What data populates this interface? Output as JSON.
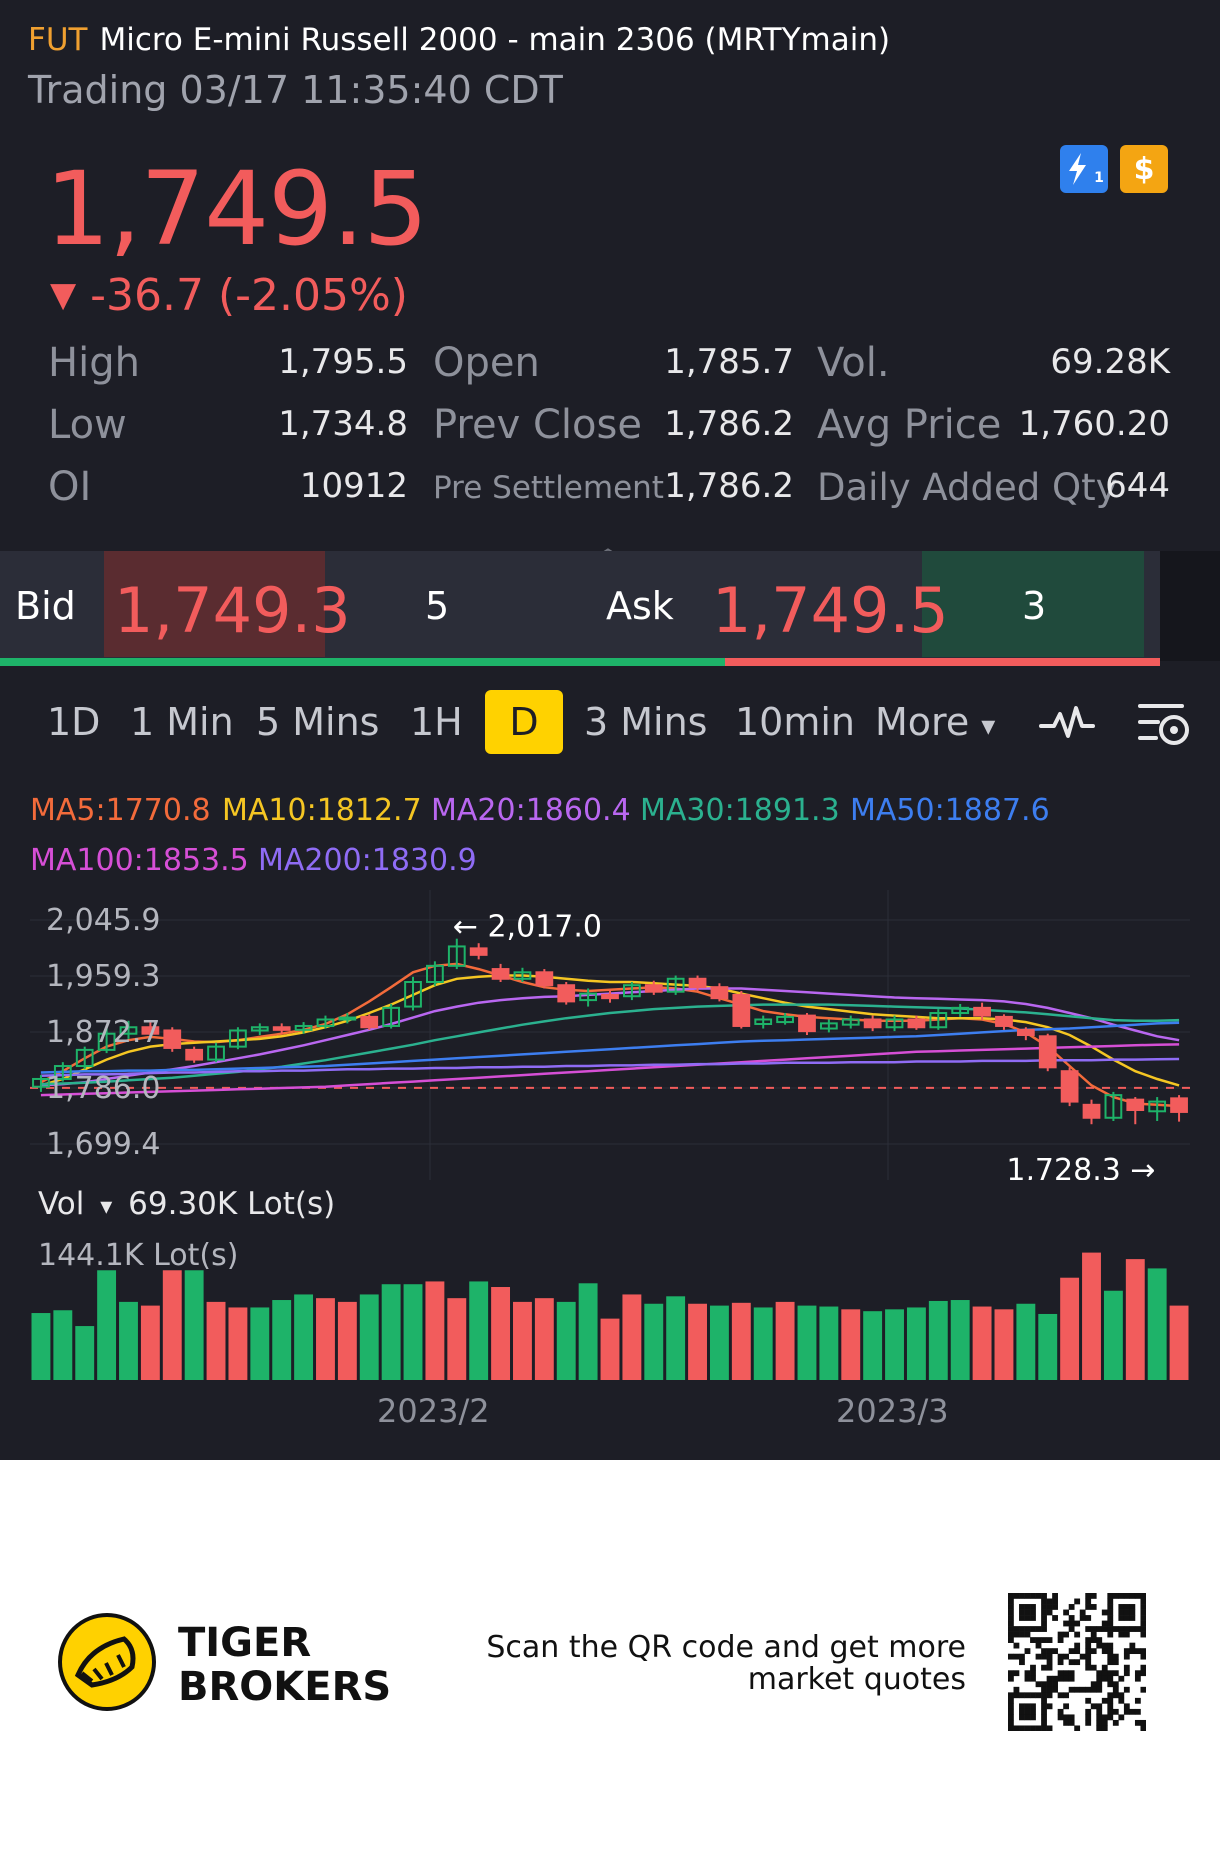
{
  "header": {
    "tag": "FUT",
    "title": "Micro E-mini Russell 2000 - main 2306 (MRTYmain)",
    "status": "Trading 03/17 11:35:40 CDT",
    "badges": {
      "flash_icon": "lightning-icon",
      "flash_sub": "1",
      "dollar_icon": "dollar-icon",
      "dollar_symbol": "$"
    }
  },
  "quote": {
    "last": "1,749.5",
    "change": "-36.7 (-2.05%)",
    "direction_arrow": "▼",
    "color_down": "#f25c5c",
    "color_up": "#1eb369"
  },
  "stats": {
    "col1": [
      {
        "label": "High",
        "value": "1,795.5"
      },
      {
        "label": "Low",
        "value": "1,734.8"
      },
      {
        "label": "OI",
        "value": "10912"
      }
    ],
    "col2": [
      {
        "label": "Open",
        "value": "1,785.7"
      },
      {
        "label": "Prev Close",
        "value": "1,786.2"
      },
      {
        "label": "Pre Settlement",
        "value": "1,786.2"
      }
    ],
    "col3": [
      {
        "label": "Vol.",
        "value": "69.28K"
      },
      {
        "label": "Avg Price",
        "value": "1,760.20"
      },
      {
        "label": "Daily Added Qty",
        "value": "644"
      }
    ],
    "collapse_caret": "︿"
  },
  "orderbook": {
    "bid_label": "Bid",
    "bid_price": "1,749.3",
    "bid_size": "5",
    "ask_label": "Ask",
    "ask_price": "1,749.5",
    "ask_size": "3"
  },
  "periods": {
    "items": [
      "1D",
      "1 Min",
      "5 Mins",
      "1H",
      "D",
      "3 Mins",
      "10min"
    ],
    "active": "D",
    "more_label": "More",
    "more_caret": "▾"
  },
  "chart_toolbar": {
    "indicator_icon": "indicator-wave-icon",
    "settings_icon": "chart-settings-icon"
  },
  "moving_averages": [
    {
      "label": "MA5:1770.8",
      "color": "#f36b3b"
    },
    {
      "label": "MA10:1812.7",
      "color": "#f5c623"
    },
    {
      "label": "MA20:1860.4",
      "color": "#b967f0"
    },
    {
      "label": "MA30:1891.3",
      "color": "#2bb18f"
    },
    {
      "label": "MA50:1887.6",
      "color": "#3d7ef0"
    },
    {
      "label": "MA100:1853.5",
      "color": "#d64fd6"
    },
    {
      "label": "MA200:1830.9",
      "color": "#8f6cf5"
    }
  ],
  "chart_data": [
    {
      "type": "candlestick",
      "title": "",
      "y_ticks": [
        "2,045.9",
        "1,959.3",
        "1,872.7",
        "1,786.0",
        "1,699.4"
      ],
      "ylim": [
        1699.4,
        2045.9
      ],
      "high_marker": "2,017.0",
      "low_marker": "1,728.3",
      "prev_close_line": 1786.2,
      "x_ticks": [
        "2023/2",
        "2023/3"
      ],
      "candles": [
        {
          "o": 1788,
          "c": 1800,
          "h": 1806,
          "l": 1780
        },
        {
          "o": 1800,
          "c": 1820,
          "h": 1826,
          "l": 1796
        },
        {
          "o": 1820,
          "c": 1845,
          "h": 1850,
          "l": 1815
        },
        {
          "o": 1845,
          "c": 1870,
          "h": 1880,
          "l": 1840
        },
        {
          "o": 1870,
          "c": 1880,
          "h": 1890,
          "l": 1862
        },
        {
          "o": 1880,
          "c": 1870,
          "h": 1888,
          "l": 1862
        },
        {
          "o": 1875,
          "c": 1848,
          "h": 1880,
          "l": 1842
        },
        {
          "o": 1845,
          "c": 1830,
          "h": 1850,
          "l": 1825
        },
        {
          "o": 1830,
          "c": 1850,
          "h": 1856,
          "l": 1826
        },
        {
          "o": 1850,
          "c": 1875,
          "h": 1880,
          "l": 1846
        },
        {
          "o": 1875,
          "c": 1880,
          "h": 1886,
          "l": 1868
        },
        {
          "o": 1880,
          "c": 1876,
          "h": 1886,
          "l": 1870
        },
        {
          "o": 1876,
          "c": 1882,
          "h": 1888,
          "l": 1870
        },
        {
          "o": 1882,
          "c": 1892,
          "h": 1898,
          "l": 1878
        },
        {
          "o": 1892,
          "c": 1895,
          "h": 1902,
          "l": 1886
        },
        {
          "o": 1896,
          "c": 1880,
          "h": 1900,
          "l": 1876
        },
        {
          "o": 1882,
          "c": 1910,
          "h": 1916,
          "l": 1878
        },
        {
          "o": 1912,
          "c": 1950,
          "h": 1958,
          "l": 1906
        },
        {
          "o": 1950,
          "c": 1975,
          "h": 1982,
          "l": 1944
        },
        {
          "o": 1975,
          "c": 2005,
          "h": 2017,
          "l": 1970
        },
        {
          "o": 2002,
          "c": 1992,
          "h": 2010,
          "l": 1985
        },
        {
          "o": 1970,
          "c": 1955,
          "h": 1978,
          "l": 1950
        },
        {
          "o": 1955,
          "c": 1965,
          "h": 1972,
          "l": 1950
        },
        {
          "o": 1965,
          "c": 1945,
          "h": 1970,
          "l": 1940
        },
        {
          "o": 1945,
          "c": 1920,
          "h": 1950,
          "l": 1915
        },
        {
          "o": 1922,
          "c": 1932,
          "h": 1940,
          "l": 1912
        },
        {
          "o": 1930,
          "c": 1925,
          "h": 1938,
          "l": 1918
        },
        {
          "o": 1928,
          "c": 1945,
          "h": 1950,
          "l": 1922
        },
        {
          "o": 1945,
          "c": 1935,
          "h": 1952,
          "l": 1930
        },
        {
          "o": 1935,
          "c": 1955,
          "h": 1960,
          "l": 1930
        },
        {
          "o": 1955,
          "c": 1942,
          "h": 1960,
          "l": 1936
        },
        {
          "o": 1942,
          "c": 1925,
          "h": 1948,
          "l": 1920
        },
        {
          "o": 1930,
          "c": 1882,
          "h": 1936,
          "l": 1878
        },
        {
          "o": 1885,
          "c": 1892,
          "h": 1898,
          "l": 1878
        },
        {
          "o": 1888,
          "c": 1896,
          "h": 1902,
          "l": 1884
        },
        {
          "o": 1898,
          "c": 1874,
          "h": 1902,
          "l": 1868
        },
        {
          "o": 1878,
          "c": 1886,
          "h": 1892,
          "l": 1872
        },
        {
          "o": 1884,
          "c": 1892,
          "h": 1898,
          "l": 1878
        },
        {
          "o": 1892,
          "c": 1880,
          "h": 1898,
          "l": 1874
        },
        {
          "o": 1880,
          "c": 1892,
          "h": 1898,
          "l": 1874
        },
        {
          "o": 1892,
          "c": 1880,
          "h": 1898,
          "l": 1876
        },
        {
          "o": 1880,
          "c": 1902,
          "h": 1908,
          "l": 1876
        },
        {
          "o": 1902,
          "c": 1910,
          "h": 1916,
          "l": 1896
        },
        {
          "o": 1910,
          "c": 1898,
          "h": 1918,
          "l": 1892
        },
        {
          "o": 1896,
          "c": 1882,
          "h": 1900,
          "l": 1876
        },
        {
          "o": 1876,
          "c": 1868,
          "h": 1880,
          "l": 1860
        },
        {
          "o": 1866,
          "c": 1818,
          "h": 1870,
          "l": 1812
        },
        {
          "o": 1812,
          "c": 1765,
          "h": 1818,
          "l": 1758
        },
        {
          "o": 1760,
          "c": 1740,
          "h": 1768,
          "l": 1730
        },
        {
          "o": 1740,
          "c": 1775,
          "h": 1780,
          "l": 1735
        },
        {
          "o": 1768,
          "c": 1752,
          "h": 1772,
          "l": 1730
        },
        {
          "o": 1750,
          "c": 1765,
          "h": 1772,
          "l": 1735
        },
        {
          "o": 1770,
          "c": 1749,
          "h": 1775,
          "l": 1734
        }
      ],
      "ma_series": [
        {
          "name": "MA5",
          "color": "#f36b3b",
          "values": [
            1795,
            1812,
            1832,
            1850,
            1860,
            1865,
            1862,
            1858,
            1857,
            1860,
            1865,
            1870,
            1876,
            1885,
            1900,
            1920,
            1942,
            1965,
            1975,
            1978,
            1970,
            1960,
            1950,
            1942,
            1938,
            1936,
            1938,
            1940,
            1942,
            1940,
            1935,
            1925,
            1915,
            1905,
            1900,
            1896,
            1894,
            1892,
            1890,
            1890,
            1890,
            1892,
            1894,
            1892,
            1885,
            1872,
            1850,
            1820,
            1790,
            1772,
            1762,
            1760,
            1758
          ]
        },
        {
          "name": "MA10",
          "color": "#f5c623",
          "values": [
            1790,
            1800,
            1815,
            1830,
            1842,
            1850,
            1854,
            1856,
            1858,
            1860,
            1862,
            1866,
            1872,
            1880,
            1890,
            1902,
            1915,
            1930,
            1945,
            1955,
            1958,
            1960,
            1960,
            1958,
            1955,
            1952,
            1950,
            1950,
            1948,
            1946,
            1944,
            1940,
            1932,
            1925,
            1918,
            1912,
            1908,
            1904,
            1900,
            1898,
            1896,
            1894,
            1894,
            1894,
            1892,
            1888,
            1880,
            1868,
            1850,
            1830,
            1812,
            1800,
            1790
          ]
        },
        {
          "name": "MA20",
          "color": "#b967f0",
          "values": [
            1790,
            1792,
            1795,
            1800,
            1805,
            1810,
            1815,
            1820,
            1826,
            1832,
            1838,
            1845,
            1852,
            1860,
            1868,
            1876,
            1885,
            1895,
            1905,
            1912,
            1918,
            1922,
            1925,
            1927,
            1928,
            1930,
            1932,
            1934,
            1936,
            1938,
            1940,
            1940,
            1940,
            1938,
            1936,
            1934,
            1932,
            1930,
            1928,
            1926,
            1925,
            1924,
            1923,
            1922,
            1920,
            1916,
            1910,
            1902,
            1894,
            1884,
            1875,
            1866,
            1860
          ]
        },
        {
          "name": "MA30",
          "color": "#2bb18f",
          "values": [
            1792,
            1793,
            1794,
            1796,
            1798,
            1800,
            1802,
            1805,
            1808,
            1811,
            1815,
            1819,
            1824,
            1829,
            1835,
            1841,
            1847,
            1853,
            1860,
            1866,
            1872,
            1878,
            1884,
            1889,
            1894,
            1898,
            1902,
            1905,
            1908,
            1910,
            1912,
            1913,
            1914,
            1915,
            1915,
            1915,
            1915,
            1914,
            1913,
            1912,
            1911,
            1910,
            1909,
            1907,
            1905,
            1903,
            1900,
            1897,
            1894,
            1891,
            1890,
            1890,
            1891
          ]
        },
        {
          "name": "MA50",
          "color": "#3d7ef0",
          "values": [
            1810,
            1811,
            1812,
            1812,
            1813,
            1813,
            1814,
            1814,
            1815,
            1816,
            1817,
            1818,
            1819,
            1820,
            1822,
            1824,
            1826,
            1828,
            1830,
            1832,
            1834,
            1836,
            1838,
            1840,
            1842,
            1844,
            1846,
            1848,
            1850,
            1852,
            1854,
            1856,
            1858,
            1859,
            1860,
            1861,
            1862,
            1863,
            1864,
            1865,
            1866,
            1868,
            1870,
            1872,
            1874,
            1876,
            1877,
            1878,
            1880,
            1882,
            1884,
            1886,
            1887
          ]
        },
        {
          "name": "MA100",
          "color": "#d64fd6",
          "values": [
            1775,
            1776,
            1777,
            1778,
            1779,
            1780,
            1781,
            1782,
            1783,
            1784,
            1785,
            1786,
            1787,
            1788,
            1790,
            1792,
            1794,
            1796,
            1798,
            1800,
            1802,
            1804,
            1806,
            1808,
            1810,
            1812,
            1814,
            1816,
            1818,
            1820,
            1822,
            1824,
            1826,
            1828,
            1830,
            1832,
            1834,
            1836,
            1838,
            1840,
            1842,
            1843,
            1844,
            1845,
            1846,
            1847,
            1848,
            1849,
            1850,
            1851,
            1852,
            1853,
            1853.5
          ]
        },
        {
          "name": "MA200",
          "color": "#8f6cf5",
          "values": [
            1805,
            1806,
            1807,
            1807,
            1808,
            1809,
            1810,
            1810,
            1811,
            1812,
            1812,
            1813,
            1813,
            1814,
            1815,
            1815,
            1816,
            1816,
            1817,
            1817,
            1818,
            1818,
            1819,
            1819,
            1820,
            1820,
            1821,
            1821,
            1822,
            1822,
            1823,
            1823,
            1824,
            1824,
            1825,
            1825,
            1825,
            1826,
            1826,
            1826,
            1827,
            1827,
            1827,
            1828,
            1828,
            1828,
            1829,
            1829,
            1829,
            1830,
            1830,
            1830.5,
            1830.9
          ]
        }
      ]
    },
    {
      "type": "bar",
      "title": "Vol",
      "selector_label": "Vol",
      "selector_caret": "▾",
      "current_label": "69.30K Lot(s)",
      "max_label": "144.1K Lot(s)",
      "unit": "K Lot(s)",
      "ylim": [
        0,
        144.1
      ],
      "values": [
        72,
        75,
        58,
        118,
        84,
        80,
        118,
        118,
        84,
        78,
        78,
        86,
        92,
        88,
        84,
        92,
        103,
        103,
        106,
        88,
        106,
        100,
        84,
        88,
        84,
        104,
        66,
        92,
        82,
        90,
        82,
        80,
        83,
        78,
        84,
        80,
        79,
        76,
        74,
        76,
        78,
        85,
        86,
        79,
        76,
        82,
        71,
        110,
        137,
        96,
        130,
        120,
        80
      ],
      "colors": [
        "g",
        "g",
        "g",
        "g",
        "g",
        "r",
        "r",
        "g",
        "r",
        "r",
        "g",
        "g",
        "g",
        "r",
        "r",
        "g",
        "g",
        "g",
        "r",
        "r",
        "g",
        "r",
        "r",
        "r",
        "g",
        "g",
        "r",
        "r",
        "g",
        "g",
        "r",
        "g",
        "r",
        "g",
        "r",
        "g",
        "g",
        "r",
        "g",
        "g",
        "g",
        "g",
        "g",
        "r",
        "r",
        "g",
        "g",
        "r",
        "r",
        "g",
        "r",
        "g",
        "r"
      ]
    }
  ],
  "footer": {
    "brand_line1": "TIGER",
    "brand_line2": "BROKERS",
    "logo_icon": "tiger-logo-icon",
    "scan_text": "Scan the QR code and get more market quotes",
    "qr_icon": "qr-code-icon"
  }
}
